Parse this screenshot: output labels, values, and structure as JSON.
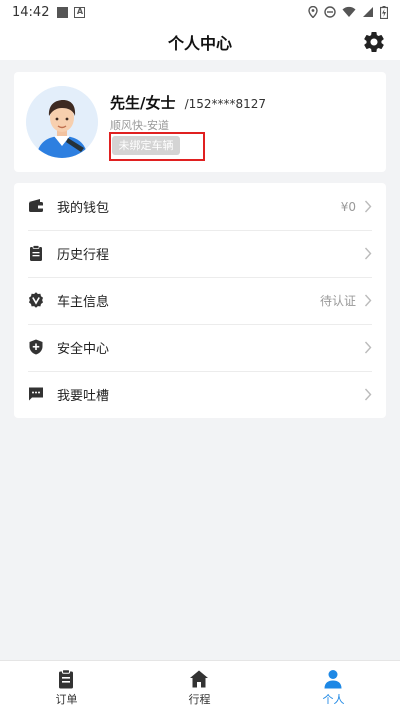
{
  "status_bar": {
    "time": "14:42"
  },
  "header": {
    "title": "个人中心",
    "settings_icon": "gear-icon"
  },
  "profile": {
    "name": "先生/女士",
    "phone": "/152****8127",
    "city": "顺风快-安道",
    "bind_vehicle_label": "未绑定车辆"
  },
  "menu": {
    "items": [
      {
        "label": "我的钱包",
        "value": "¥0",
        "icon": "wallet-icon"
      },
      {
        "label": "历史行程",
        "value": "",
        "icon": "clipboard-icon"
      },
      {
        "label": "车主信息",
        "value": "待认证",
        "icon": "verified-badge-icon"
      },
      {
        "label": "安全中心",
        "value": "",
        "icon": "shield-icon"
      },
      {
        "label": "我要吐槽",
        "value": "",
        "icon": "chat-icon"
      }
    ]
  },
  "tabbar": {
    "tabs": [
      {
        "label": "订单",
        "icon": "clipboard-icon",
        "active": false
      },
      {
        "label": "行程",
        "icon": "home-icon",
        "active": false
      },
      {
        "label": "个人",
        "icon": "person-icon",
        "active": true
      }
    ]
  },
  "colors": {
    "accent": "#1e88e5",
    "highlight_border": "#e02020",
    "background": "#f2f3f5"
  }
}
